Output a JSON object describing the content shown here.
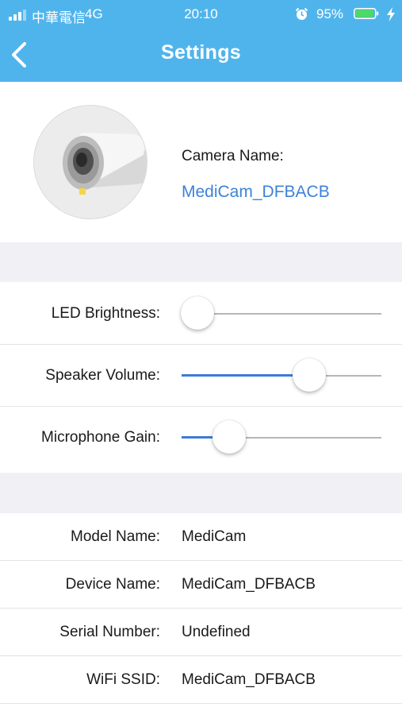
{
  "status_bar": {
    "carrier": "中華電信",
    "network": "4G",
    "time": "20:10",
    "battery_percent": "95%",
    "battery_level": 0.95
  },
  "nav": {
    "title": "Settings",
    "back_icon": "chevron-left-icon"
  },
  "camera": {
    "name_label": "Camera Name:",
    "name_value": "MediCam_DFBACB"
  },
  "sliders": [
    {
      "label": "LED Brightness:",
      "level": 0.08
    },
    {
      "label": "Speaker Volume:",
      "level": 0.64
    },
    {
      "label": "Microphone Gain:",
      "level": 0.24
    }
  ],
  "info": [
    {
      "label": "Model Name:",
      "value": "MediCam"
    },
    {
      "label": "Device Name:",
      "value": "MediCam_DFBACB"
    },
    {
      "label": "Serial Number:",
      "value": "Undefined"
    },
    {
      "label": "WiFi SSID:",
      "value": "MediCam_DFBACB"
    }
  ],
  "colors": {
    "header": "#50b4ec",
    "accent": "#3c82d8",
    "battery": "#4cd964",
    "background": "#f0f0f5"
  }
}
